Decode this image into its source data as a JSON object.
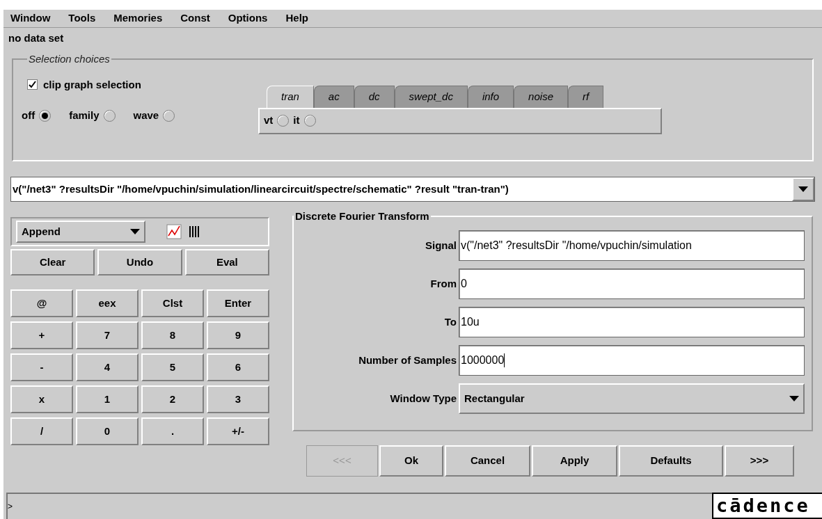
{
  "menu": [
    "Window",
    "Tools",
    "Memories",
    "Const",
    "Options",
    "Help"
  ],
  "data_status": "no data set",
  "selection": {
    "title": "Selection choices",
    "clip": {
      "label": "clip graph selection",
      "checked": true
    },
    "modes": [
      {
        "label": "off",
        "selected": true
      },
      {
        "label": "family",
        "selected": false
      },
      {
        "label": "wave",
        "selected": false
      }
    ],
    "tabs": [
      {
        "label": "tran",
        "selected": true
      },
      {
        "label": "ac",
        "selected": false
      },
      {
        "label": "dc",
        "selected": false
      },
      {
        "label": "swept_dc",
        "selected": false
      },
      {
        "label": "info",
        "selected": false
      },
      {
        "label": "noise",
        "selected": false
      },
      {
        "label": "rf",
        "selected": false
      }
    ],
    "tab_options": [
      {
        "label": "vt",
        "selected": false
      },
      {
        "label": "it",
        "selected": false
      }
    ]
  },
  "expression": "v(\"/net3\" ?resultsDir \"/home/vpuchin/simulation/linearcircuit/spectre/schematic\" ?result \"tran-tran\")",
  "calculator": {
    "mode": "Append",
    "actions": [
      "Clear",
      "Undo",
      "Eval"
    ],
    "keys": [
      "@",
      "eex",
      "Clst",
      "Enter",
      "+",
      "7",
      "8",
      "9",
      "-",
      "4",
      "5",
      "6",
      "x",
      "1",
      "2",
      "3",
      "/",
      "0",
      ".",
      "+/-"
    ]
  },
  "dft": {
    "title": "Discrete Fourier Transform",
    "fields": [
      {
        "label": "Signal",
        "value": "v(\"/net3\" ?resultsDir \"/home/vpuchin/simulation",
        "kind": "text"
      },
      {
        "label": "From",
        "value": "0",
        "kind": "text"
      },
      {
        "label": "To",
        "value": "10u",
        "kind": "text"
      },
      {
        "label": "Number of Samples",
        "value": "1000000",
        "kind": "text"
      },
      {
        "label": "Window Type",
        "value": "Rectangular",
        "kind": "select"
      }
    ]
  },
  "buttons": [
    {
      "label": "<<<",
      "disabled": true
    },
    {
      "label": "Ok",
      "disabled": false
    },
    {
      "label": "Cancel",
      "disabled": false
    },
    {
      "label": "Apply",
      "disabled": false
    },
    {
      "label": "Defaults",
      "disabled": false
    },
    {
      "label": ">>>",
      "disabled": false
    }
  ],
  "prompt": ">",
  "logo": "cādence"
}
